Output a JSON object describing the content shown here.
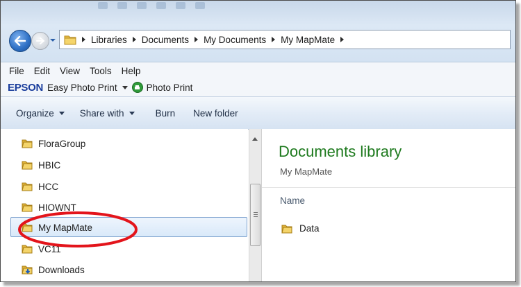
{
  "address_bar": {
    "crumbs": [
      "Libraries",
      "Documents",
      "My Documents",
      "My MapMate"
    ]
  },
  "menu": {
    "items": [
      "File",
      "Edit",
      "View",
      "Tools",
      "Help"
    ]
  },
  "epson": {
    "logo": "EPSON",
    "easy_photo_print": "Easy Photo Print",
    "photo_print": "Photo Print"
  },
  "commands": {
    "organize": "Organize",
    "share_with": "Share with",
    "burn": "Burn",
    "new_folder": "New folder"
  },
  "nav_tree": {
    "items": [
      {
        "label": "FloraGroup",
        "icon": "folder-icon"
      },
      {
        "label": "HBIC",
        "icon": "folder-icon"
      },
      {
        "label": "HCC",
        "icon": "folder-icon"
      },
      {
        "label": "HIOWNT",
        "icon": "folder-icon"
      },
      {
        "label": "My MapMate",
        "icon": "folder-icon",
        "selected": true
      },
      {
        "label": "VC11",
        "icon": "folder-icon"
      },
      {
        "label": "Downloads",
        "icon": "downloads-folder-icon"
      }
    ]
  },
  "library": {
    "title": "Documents library",
    "subtitle": "My MapMate",
    "column_name": "Name",
    "files": [
      {
        "label": "Data",
        "icon": "folder-icon"
      }
    ]
  },
  "colors": {
    "library_title": "#1e7a1e",
    "highlight_ellipse": "#e3141b",
    "epson_blue": "#1a3d9c"
  }
}
